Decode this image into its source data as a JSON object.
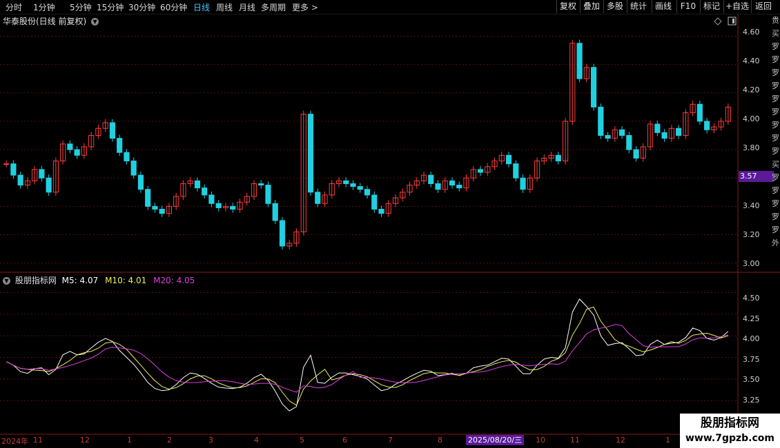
{
  "toolbar": {
    "periods": [
      "分时",
      "1分钟",
      "5分钟",
      "15分钟",
      "30分钟",
      "60分钟",
      "日线",
      "周线",
      "月线",
      "多周期",
      "更多 >"
    ],
    "active_period": "日线",
    "right_buttons": [
      "复权",
      "叠加",
      "多股",
      "统计",
      "画线",
      "F10",
      "标记",
      "+自选",
      "返回"
    ]
  },
  "stock": {
    "title": "华泰股份(日线 前复权)"
  },
  "price_axis": [
    "4.60",
    "4.40",
    "4.20",
    "4.00",
    "3.80",
    "3.40",
    "3.20",
    "3.00"
  ],
  "current_price": "3.57",
  "indicator": {
    "name": "股朋指标网",
    "m5_label": "M5: 4.07",
    "m10_label": "M10: 4.01",
    "m20_label": "M20: 4.05",
    "axis": [
      "4.50",
      "4.25",
      "4.00",
      "3.75",
      "3.50",
      "3.25"
    ]
  },
  "dates": {
    "ticks": [
      "2024年",
      "11",
      "12",
      "1",
      "2",
      "3",
      "4",
      "5",
      "6",
      "7",
      "8",
      "10",
      "11",
      "12",
      "1"
    ],
    "highlight": "2025/08/20/三"
  },
  "sidebar_chars": [
    "贵",
    "买",
    "罗",
    "罗",
    "罗",
    "罗",
    "罗",
    "罗",
    "罗",
    "罗",
    "罗",
    "买",
    "罗",
    "罗",
    "罗",
    "罗",
    "罗",
    "外"
  ],
  "watermark": {
    "line1": "股朋指标网",
    "line2": "www.7gpzb.com"
  },
  "colors": {
    "up": "#ff3d3d",
    "down": "#20d0e0",
    "m5": "#ffffff",
    "m10": "#f0f060",
    "m20": "#e040e0",
    "active_period": "#4ec2ff",
    "highlight_bg": "#5a1a9a"
  },
  "chart_data": {
    "type": "line",
    "title": "华泰股份(日线 前复权)",
    "ylim_price": [
      2.95,
      4.68
    ],
    "ylim_indicator": [
      3.1,
      4.6
    ],
    "closes": [
      3.7,
      3.62,
      3.55,
      3.58,
      3.66,
      3.6,
      3.5,
      3.72,
      3.84,
      3.8,
      3.76,
      3.82,
      3.9,
      3.95,
      3.99,
      3.88,
      3.78,
      3.72,
      3.62,
      3.52,
      3.4,
      3.38,
      3.35,
      3.4,
      3.47,
      3.56,
      3.58,
      3.53,
      3.48,
      3.42,
      3.39,
      3.4,
      3.38,
      3.43,
      3.47,
      3.56,
      3.55,
      3.42,
      3.3,
      3.12,
      3.14,
      3.22,
      4.05,
      3.5,
      3.42,
      3.48,
      3.56,
      3.58,
      3.56,
      3.54,
      3.52,
      3.48,
      3.38,
      3.35,
      3.42,
      3.46,
      3.5,
      3.55,
      3.58,
      3.62,
      3.56,
      3.52,
      3.58,
      3.55,
      3.53,
      3.6,
      3.66,
      3.64,
      3.68,
      3.72,
      3.76,
      3.7,
      3.6,
      3.52,
      3.6,
      3.72,
      3.74,
      3.76,
      3.72,
      4.0,
      4.55,
      4.3,
      4.38,
      4.1,
      3.9,
      3.88,
      3.94,
      3.9,
      3.8,
      3.74,
      3.82,
      3.98,
      3.92,
      3.88,
      3.95,
      3.9,
      4.06,
      4.12,
      4.0,
      3.94,
      3.96,
      4.0,
      4.1
    ]
  }
}
